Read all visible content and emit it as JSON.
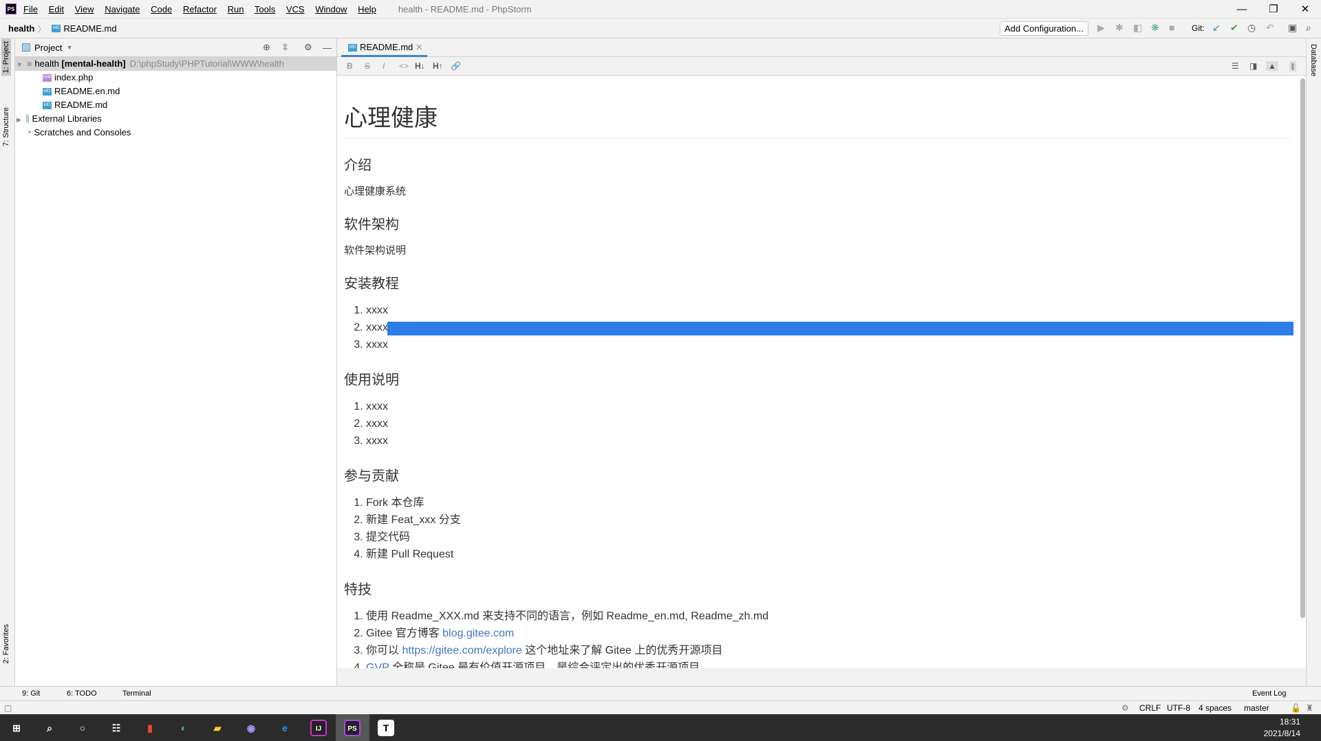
{
  "window": {
    "title": "health - README.md - PhpStorm",
    "menu": [
      "File",
      "Edit",
      "View",
      "Navigate",
      "Code",
      "Refactor",
      "Run",
      "Tools",
      "VCS",
      "Window",
      "Help"
    ]
  },
  "navbar": {
    "project": "health",
    "file": "README.md",
    "add_config": "Add Configuration...",
    "git_label": "Git:"
  },
  "left_strip": {
    "tabs": [
      "1: Project",
      "7: Structure",
      "2: Favorites"
    ]
  },
  "right_strip": {
    "tabs": [
      "Database"
    ]
  },
  "project_panel": {
    "title": "Project",
    "root": {
      "name": "health",
      "module": "[mental-health]",
      "path": "D:\\phpStudy\\PHPTutorial\\WWW\\health"
    },
    "files": [
      "index.php",
      "README.en.md",
      "README.md"
    ],
    "others": [
      "External Libraries",
      "Scratches and Consoles"
    ]
  },
  "editor": {
    "tab": "README.md",
    "toolbar": [
      "B",
      "S",
      "I",
      "<>",
      "H↓",
      "H↑",
      "🔗"
    ]
  },
  "doc": {
    "h1": "心理健康",
    "s1": {
      "h": "介绍",
      "p": "心理健康系统"
    },
    "s2": {
      "h": "软件架构",
      "p": "软件架构说明"
    },
    "s3": {
      "h": "安装教程",
      "items": [
        "xxxx",
        "xxxx",
        "xxxx"
      ]
    },
    "s4": {
      "h": "使用说明",
      "items": [
        "xxxx",
        "xxxx",
        "xxxx"
      ]
    },
    "s5": {
      "h": "参与贡献",
      "items": [
        "Fork 本仓库",
        "新建 Feat_xxx 分支",
        "提交代码",
        "新建 Pull Request"
      ]
    },
    "s6": {
      "h": "特技",
      "i1": "使用 Readme_XXX.md 来支持不同的语言，例如 Readme_en.md, Readme_zh.md",
      "i2a": "Gitee 官方博客 ",
      "i2link": "blog.gitee.com",
      "i3a": "你可以 ",
      "i3link": "https://gitee.com/explore",
      "i3b": " 这个地址来了解 Gitee 上的优秀开源项目",
      "i4link": "GVP",
      "i4b": " 全称是 Gitee 最有价值开源项目，是综合评定出的优秀开源项目"
    }
  },
  "tool_strip": {
    "git": "9: Git",
    "todo": "6: TODO",
    "terminal": "Terminal",
    "event_log": "Event Log"
  },
  "status": {
    "line_sep": "CRLF",
    "encoding": "UTF-8",
    "indent": "4 spaces",
    "branch": "master"
  },
  "taskbar": {
    "time": "18:31",
    "date": "2021/8/14"
  },
  "colors": {
    "accent": "#4083c9",
    "selection": "#2e7ce6",
    "link": "#4078c0"
  }
}
